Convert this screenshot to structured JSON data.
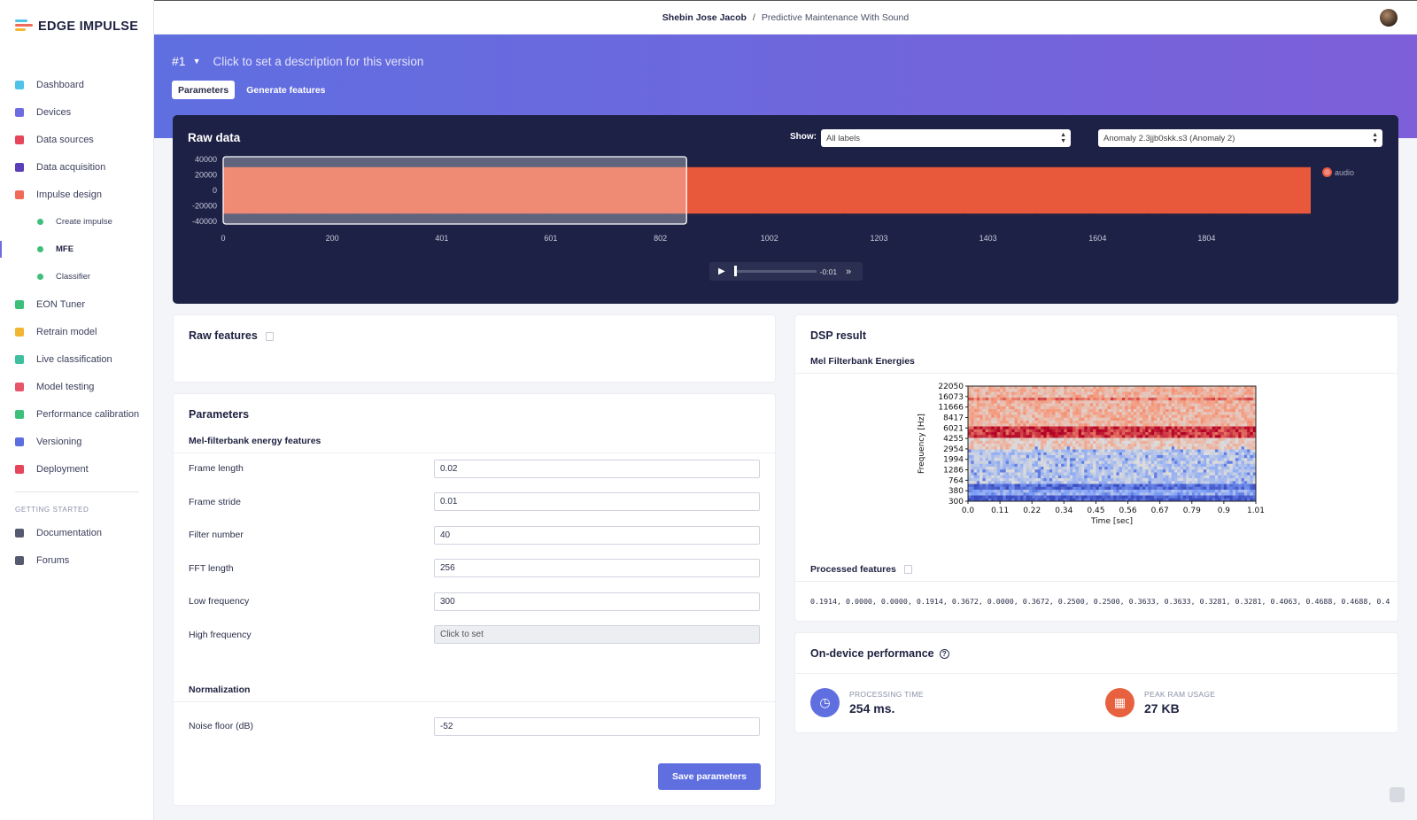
{
  "app": {
    "logo_text": "EDGE IMPULSE"
  },
  "header": {
    "user": "Shebin Jose Jacob",
    "separator": "/",
    "project": "Predictive Maintenance With Sound"
  },
  "sidebar": {
    "items": [
      {
        "label": "Dashboard",
        "icon": "monitor-icon",
        "color": "#4fc3e8"
      },
      {
        "label": "Devices",
        "icon": "device-icon",
        "color": "#6e6de0"
      },
      {
        "label": "Data sources",
        "icon": "wand-icon",
        "color": "#e6455a"
      },
      {
        "label": "Data acquisition",
        "icon": "database-icon",
        "color": "#5b3fb8"
      },
      {
        "label": "Impulse design",
        "icon": "pulse-icon",
        "color": "#f06a5a"
      },
      {
        "label": "Create impulse",
        "sub": true
      },
      {
        "label": "MFE",
        "sub": true,
        "active": true
      },
      {
        "label": "Classifier",
        "sub": true
      },
      {
        "label": "EON Tuner",
        "icon": "compass-icon",
        "color": "#3ec07a"
      },
      {
        "label": "Retrain model",
        "icon": "shuffle-icon",
        "color": "#f2b632"
      },
      {
        "label": "Live classification",
        "icon": "signal-icon",
        "color": "#3ec0a0"
      },
      {
        "label": "Model testing",
        "icon": "clipboard-icon",
        "color": "#e6556a"
      },
      {
        "label": "Performance calibration",
        "icon": "chart-icon",
        "color": "#3ec07a"
      },
      {
        "label": "Versioning",
        "icon": "branch-icon",
        "color": "#5b6fe0"
      },
      {
        "label": "Deployment",
        "icon": "box-icon",
        "color": "#e6455a"
      }
    ],
    "section_label": "GETTING STARTED",
    "bottom_items": [
      {
        "label": "Documentation",
        "icon": "rocket-icon",
        "color": "#555a70"
      },
      {
        "label": "Forums",
        "icon": "chat-icon",
        "color": "#555a70"
      }
    ]
  },
  "hero": {
    "version": "#1",
    "description": "Click to set a description for this version",
    "tabs": [
      "Parameters",
      "Generate features"
    ]
  },
  "raw_data": {
    "title": "Raw data",
    "show_label": "Show:",
    "filter_value": "All labels",
    "sample_value": "Anomaly 2.3jjb0skk.s3 (Anomaly 2)",
    "legend": "audio",
    "player_time": "-0:01"
  },
  "raw_features": {
    "title": "Raw features"
  },
  "parameters": {
    "title": "Parameters",
    "section1": "Mel-filterbank energy features",
    "rows": [
      {
        "label": "Frame length",
        "value": "0.02"
      },
      {
        "label": "Frame stride",
        "value": "0.01"
      },
      {
        "label": "Filter number",
        "value": "40"
      },
      {
        "label": "FFT length",
        "value": "256"
      },
      {
        "label": "Low frequency",
        "value": "300"
      },
      {
        "label": "High frequency",
        "value": "Click to set",
        "unset": true
      }
    ],
    "section2": "Normalization",
    "noise_row": {
      "label": "Noise floor (dB)",
      "value": "-52"
    },
    "save_label": "Save parameters"
  },
  "dsp": {
    "title": "DSP result",
    "subtitle": "Mel Filterbank Energies",
    "processed_label": "Processed features",
    "processed_values": "0.1914, 0.0000, 0.0000, 0.1914, 0.3672, 0.0000, 0.3672, 0.2500, 0.2500, 0.3633, 0.3633, 0.3281, 0.3281, 0.4063, 0.4688, 0.4688, 0.4"
  },
  "performance": {
    "title": "On-device performance",
    "processing_label": "PROCESSING TIME",
    "processing_value": "254 ms.",
    "ram_label": "PEAK RAM USAGE",
    "ram_value": "27 KB",
    "colors": {
      "processing": "#5f6fe0",
      "ram": "#e8613f"
    }
  },
  "chart_data": [
    {
      "type": "area",
      "name": "raw-data-waveform",
      "series": [
        {
          "name": "audio",
          "color": "#e8583a"
        }
      ],
      "x_ticks": [
        "0",
        "200",
        "401",
        "601",
        "802",
        "1002",
        "1203",
        "1403",
        "1604",
        "1804"
      ],
      "y_ticks": [
        "40000",
        "20000",
        "0",
        "-20000",
        "-40000"
      ],
      "xlim": [
        0,
        1995
      ],
      "ylim": [
        -40000,
        40000
      ],
      "amplitude": [
        -30000,
        30000
      ],
      "selection": [
        0,
        850
      ]
    },
    {
      "type": "heatmap",
      "name": "mel-filterbank-energies",
      "xlabel": "Time [sec]",
      "ylabel": "Frequency [Hz]",
      "x_ticks": [
        "0.0",
        "0.11",
        "0.22",
        "0.34",
        "0.45",
        "0.56",
        "0.67",
        "0.79",
        "0.9",
        "1.01"
      ],
      "y_ticks": [
        "22050",
        "16073",
        "11666",
        "8417",
        "6021",
        "4255",
        "2954",
        "1994",
        "1286",
        "764",
        "380",
        "300"
      ],
      "rows": 40,
      "cols": 99
    }
  ]
}
